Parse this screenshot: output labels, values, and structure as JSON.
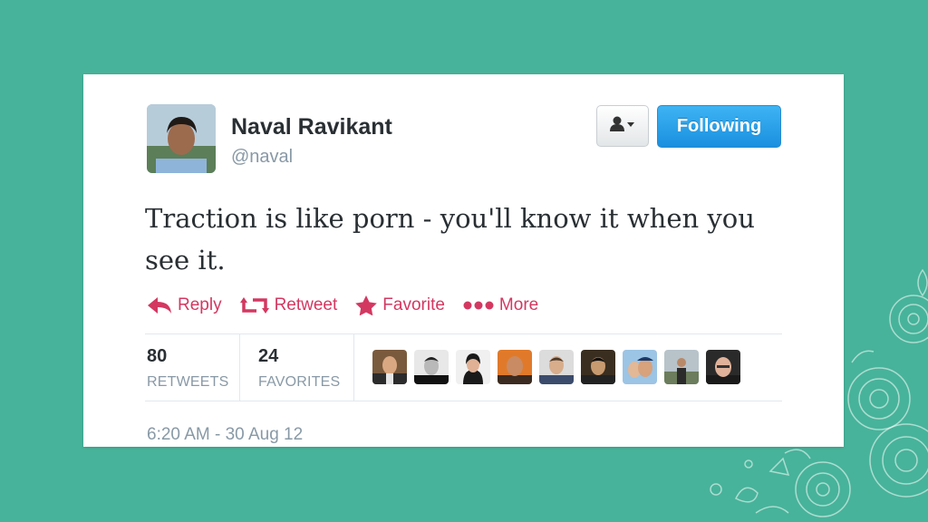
{
  "tweet": {
    "display_name": "Naval Ravikant",
    "screen_name": "@naval",
    "text": "Traction is like porn - you'll know it when you see it.",
    "timestamp": "6:20 AM - 30 Aug 12"
  },
  "buttons": {
    "user_dropdown_icon": "person-icon",
    "follow_label": "Following"
  },
  "actions": [
    {
      "label": "Reply",
      "icon": "reply-icon"
    },
    {
      "label": "Retweet",
      "icon": "retweet-icon"
    },
    {
      "label": "Favorite",
      "icon": "star-icon"
    },
    {
      "label": "More",
      "icon": "more-dots-icon"
    }
  ],
  "stats": {
    "retweets_count": "80",
    "retweets_label": "RETWEETS",
    "favorites_count": "24",
    "favorites_label": "FAVORITES"
  },
  "colors": {
    "background": "#47b39a",
    "action": "#d33861",
    "follow_button": "#2a9be9",
    "name": "#292f33",
    "muted": "#8899a6"
  }
}
